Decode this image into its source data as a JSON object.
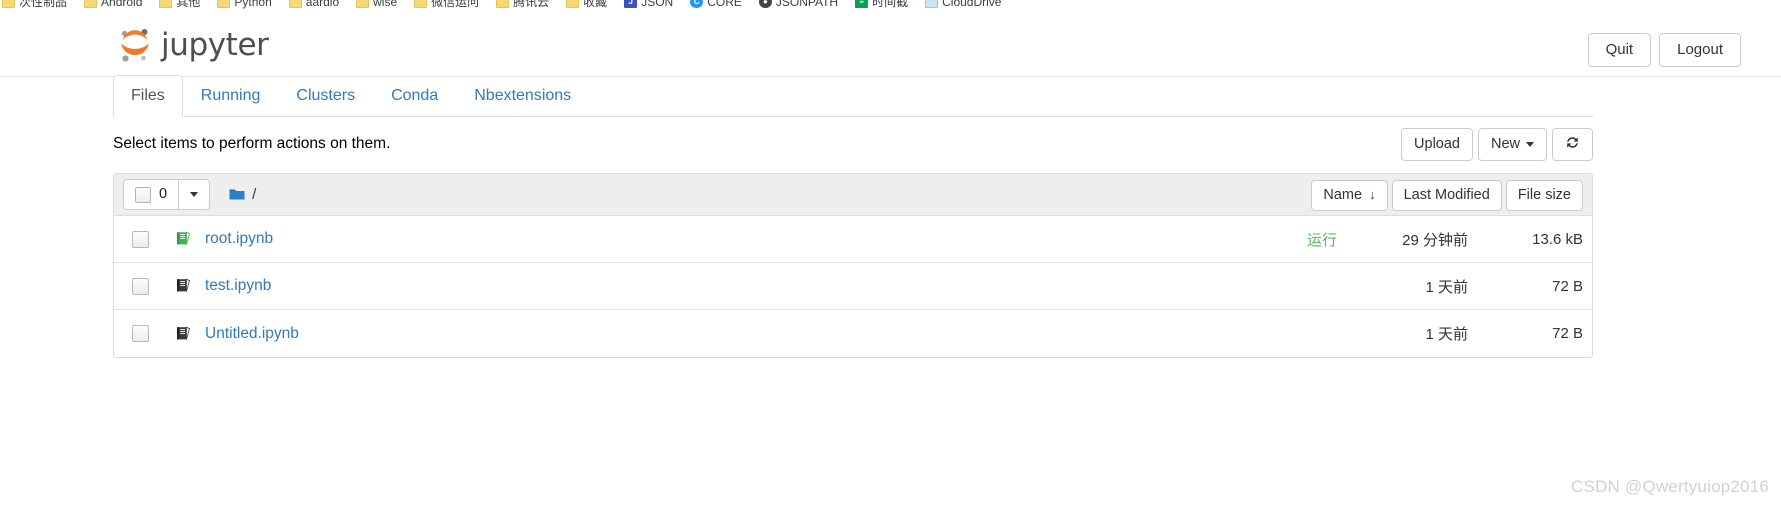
{
  "browser": {
    "bookmarks": [
      {
        "label": "次性制品",
        "icon": "folder-icon"
      },
      {
        "label": "Android",
        "icon": "folder-icon"
      },
      {
        "label": "其他",
        "icon": "folder-icon"
      },
      {
        "label": "Python",
        "icon": "folder-icon"
      },
      {
        "label": "aardio",
        "icon": "folder-icon"
      },
      {
        "label": "wise",
        "icon": "folder-icon"
      },
      {
        "label": "微信运问",
        "icon": "folder-icon"
      },
      {
        "label": "腾讯云",
        "icon": "folder-icon"
      },
      {
        "label": "收藏",
        "icon": "folder-icon"
      },
      {
        "label": "JSON",
        "icon": "json-icon",
        "glyph": "J"
      },
      {
        "label": "CORE",
        "icon": "core-icon",
        "glyph": "C"
      },
      {
        "label": "JSONPATH",
        "icon": "jsonpath-icon",
        "glyph": "●"
      },
      {
        "label": "时间截",
        "icon": "sheet-icon",
        "glyph": "≡"
      },
      {
        "label": "CloudDrive",
        "icon": "clouddrive-icon"
      }
    ]
  },
  "header": {
    "logo_text": "jupyter",
    "logo_color": "#f37726",
    "buttons": [
      {
        "label": "Quit",
        "name": "quit-button"
      },
      {
        "label": "Logout",
        "name": "logout-button"
      }
    ]
  },
  "tabs": [
    {
      "label": "Files",
      "active": true
    },
    {
      "label": "Running",
      "active": false
    },
    {
      "label": "Clusters",
      "active": false
    },
    {
      "label": "Conda",
      "active": false
    },
    {
      "label": "Nbextensions",
      "active": false
    }
  ],
  "actions": {
    "hint": "Select items to perform actions on them.",
    "upload_label": "Upload",
    "new_label": "New",
    "refresh_icon": "refresh-icon"
  },
  "list_toolbar": {
    "selected_count": "0",
    "breadcrumb_root": "/",
    "folder_icon": "folder-icon",
    "sort": {
      "name_label": "Name",
      "name_arrow": "↓",
      "modified_label": "Last Modified",
      "size_label": "File size"
    }
  },
  "files": [
    {
      "name": "root.ipynb",
      "icon": "notebook-running-icon",
      "running": true,
      "running_label": "运行",
      "modified": "29 分钟前",
      "size": "13.6 kB"
    },
    {
      "name": "test.ipynb",
      "icon": "notebook-icon",
      "running": false,
      "running_label": "",
      "modified": "1 天前",
      "size": "72 B"
    },
    {
      "name": "Untitled.ipynb",
      "icon": "notebook-icon",
      "running": false,
      "running_label": "",
      "modified": "1 天前",
      "size": "72 B"
    }
  ],
  "watermark": "CSDN @Qwertyuiop2016",
  "colors": {
    "link": "#337ab7",
    "running_green": "#5cb85c",
    "jupyter_orange": "#f37726",
    "toolbar_bg": "#eeeeee"
  }
}
